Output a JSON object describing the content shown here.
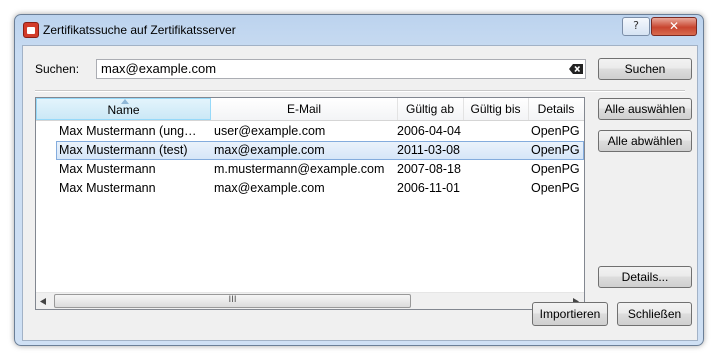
{
  "window": {
    "title": "Zertifikatssuche auf Zertifikatsserver",
    "help_glyph": "?",
    "close_glyph": "✕"
  },
  "search": {
    "label": "Suchen:",
    "value": "max@example.com",
    "button_label": "Suchen"
  },
  "table": {
    "columns": [
      "Name",
      "E-Mail",
      "Gültig ab",
      "Gültig bis",
      "Details"
    ],
    "sorted_column": "Name",
    "rows": [
      {
        "name": "Max Mustermann (ung…",
        "email": "user@example.com",
        "valid_from": "2006-04-04",
        "valid_to": "",
        "details": "OpenPG"
      },
      {
        "name": "Max Mustermann (test)",
        "email": "max@example.com",
        "valid_from": "2011-03-08",
        "valid_to": "",
        "details": "OpenPG"
      },
      {
        "name": "Max Mustermann",
        "email": "m.mustermann@example.com",
        "valid_from": "2007-08-18",
        "valid_to": "",
        "details": "OpenPG"
      },
      {
        "name": "Max Mustermann",
        "email": "max@example.com",
        "valid_from": "2006-11-01",
        "valid_to": "",
        "details": "OpenPG"
      }
    ],
    "selected_row": 1,
    "scroll_grip": "III"
  },
  "side_buttons": {
    "select_all": "Alle auswählen",
    "deselect_all": "Alle abwählen",
    "details": "Details..."
  },
  "footer": {
    "import": "Importieren",
    "close": "Schließen"
  }
}
